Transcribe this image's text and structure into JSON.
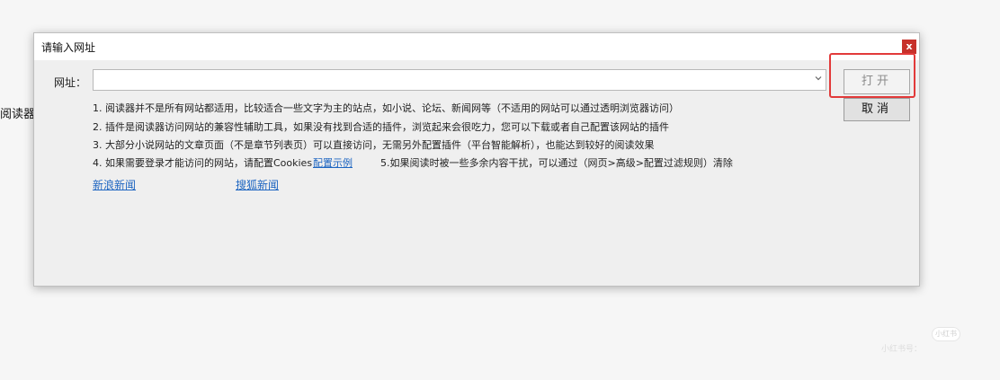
{
  "background": {
    "partial_text": "阅读器，"
  },
  "dialog": {
    "title": "请输入网址",
    "close_label": "x",
    "url_label": "网址：",
    "url_value": "",
    "dropdown_icon": "chevron-down-icon",
    "open_label": "打开",
    "cancel_label": "取消",
    "notes": [
      "1. 阅读器并不是所有网站都适用，比较适合一些文字为主的站点，如小说、论坛、新闻网等（不适用的网站可以通过透明浏览器访问）",
      "2. 插件是阅读器访问网站的兼容性辅助工具，如果没有找到合适的插件，浏览起来会很吃力，您可以下载或者自己配置该网站的插件",
      "3. 大部分小说网站的文章页面（不是章节列表页）可以直接访问，无需另外配置插件（平台智能解析），也能达到较好的阅读效果",
      "4. 如果需要登录才能访问的网站，请配置Cookies"
    ],
    "note4_link": "配置示例",
    "note5": "5.如果阅读时被一些多余内容干扰，可以通过（网页>高级>配置过滤规则）清除",
    "quick_links": [
      "新浪新闻",
      "搜狐新闻"
    ]
  },
  "watermark": {
    "badge": "小红书",
    "text": "小红书号："
  },
  "colors": {
    "highlight": "#e23a3a",
    "close": "#c7312b",
    "link": "#1d65c1"
  }
}
